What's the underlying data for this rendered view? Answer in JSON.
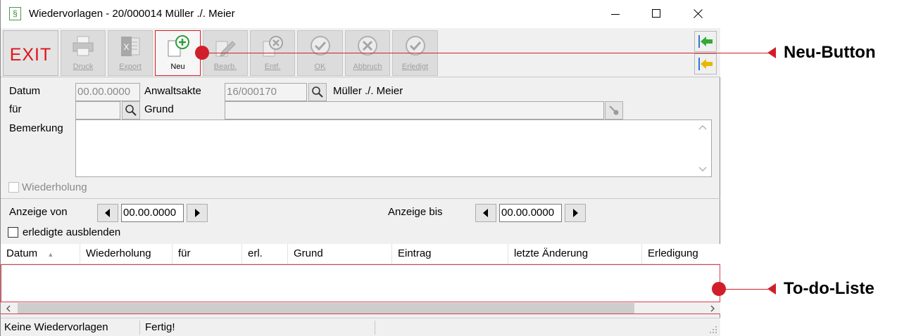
{
  "window": {
    "title": "Wiedervorlagen - 20/000014 Müller ./. Meier",
    "icon_glyph": "§"
  },
  "toolbar": {
    "exit_label": "EXIT",
    "buttons": [
      {
        "label": "Druck",
        "icon": "printer-icon"
      },
      {
        "label": "Export",
        "icon": "excel-icon"
      },
      {
        "label": "Neu",
        "icon": "new-doc-plus-icon"
      },
      {
        "label": "Bearb.",
        "icon": "edit-pencil-icon"
      },
      {
        "label": "Entf.",
        "icon": "delete-doc-icon"
      },
      {
        "label": "OK",
        "icon": "check-circle-icon"
      },
      {
        "label": "Abbruch",
        "icon": "cancel-circle-icon"
      },
      {
        "label": "Erledigt",
        "icon": "check-circle-icon"
      }
    ]
  },
  "form": {
    "datum_label": "Datum",
    "datum_value": "00.00.0000",
    "anwaltsakte_label": "Anwaltsakte",
    "anwaltsakte_value": "16/000170",
    "anwaltsakte_name": "Müller ./. Meier",
    "fuer_label": "für",
    "fuer_value": "",
    "grund_label": "Grund",
    "grund_value": "",
    "bemerkung_label": "Bemerkung",
    "wiederholung_label": "Wiederholung"
  },
  "filter": {
    "anzeige_von_label": "Anzeige von",
    "anzeige_von_value": "00.00.0000",
    "anzeige_bis_label": "Anzeige bis",
    "anzeige_bis_value": "00.00.0000",
    "erledigte_label": "erledigte ausblenden"
  },
  "table": {
    "columns": [
      "Datum",
      "Wiederholung",
      "für",
      "erl.",
      "Grund",
      "Eintrag",
      "letzte Änderung",
      "Erledigung"
    ],
    "sort_indicator": "▲",
    "rows": []
  },
  "status": {
    "left": "Keine Wiedervorlagen",
    "middle": "Fertig!"
  },
  "annotations": {
    "neu_button": "Neu-Button",
    "todo_list": "To-do-Liste"
  },
  "colors": {
    "accent_red": "#d01f2a",
    "exit_red": "#e0141a"
  }
}
